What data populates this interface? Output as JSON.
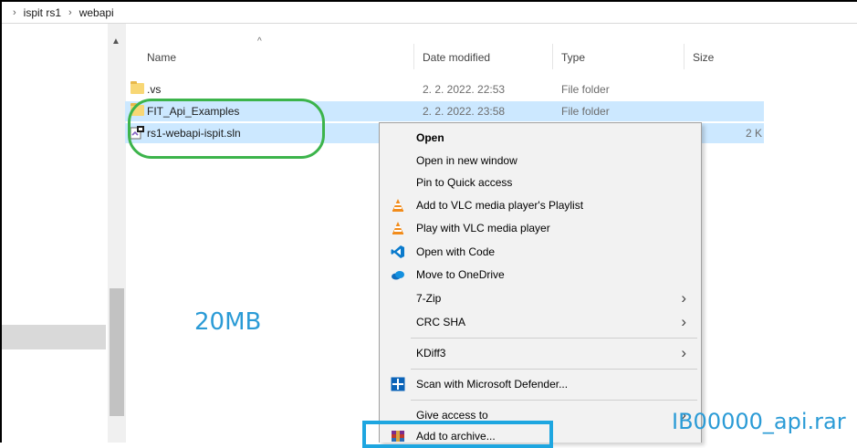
{
  "breadcrumb": [
    "ispit rs1",
    "webapi"
  ],
  "columns": {
    "name": "Name",
    "date": "Date modified",
    "type": "Type",
    "size": "Size"
  },
  "files": [
    {
      "name": ".vs",
      "date": "2. 2. 2022. 22:53",
      "type": "File folder",
      "size": "",
      "icon": "folder-icon",
      "selected": false
    },
    {
      "name": "FIT_Api_Examples",
      "date": "2. 2. 2022. 23:58",
      "type": "File folder",
      "size": "",
      "icon": "folder-icon",
      "selected": true
    },
    {
      "name": "rs1-webapi-ispit.sln",
      "date": "",
      "type": "",
      "size": "2 K",
      "icon": "visual-studio-solution-icon",
      "selected": true
    }
  ],
  "context_menu": {
    "items": [
      {
        "label": "Open",
        "bold": true,
        "icon": ""
      },
      {
        "label": "Open in new window",
        "icon": ""
      },
      {
        "label": "Pin to Quick access",
        "icon": ""
      },
      {
        "label": "Add to VLC media player's Playlist",
        "icon": "vlc-icon"
      },
      {
        "label": "Play with VLC media player",
        "icon": "vlc-icon"
      },
      {
        "label": "Open with Code",
        "icon": "vscode-icon"
      },
      {
        "label": "Move to OneDrive",
        "icon": "onedrive-icon"
      },
      {
        "label": "7-Zip",
        "submenu": true
      },
      {
        "label": "CRC SHA",
        "submenu": true
      },
      {
        "label": "KDiff3",
        "submenu": true
      },
      {
        "label": "Scan with Microsoft Defender...",
        "icon": "defender-icon"
      },
      {
        "label": "Give access to",
        "submenu": true
      },
      {
        "label": "Add to archive...",
        "icon": "winrar-icon"
      }
    ]
  },
  "annotations": {
    "size_note": "20MB",
    "archive_note": "IB00000_api.rar",
    "note_color": "#2b9bd6",
    "ring_color": "#3cb44b",
    "box_color": "#1ea6e0"
  },
  "colors": {
    "selection": "#cce8ff",
    "menu_bg": "#f2f2f2"
  }
}
